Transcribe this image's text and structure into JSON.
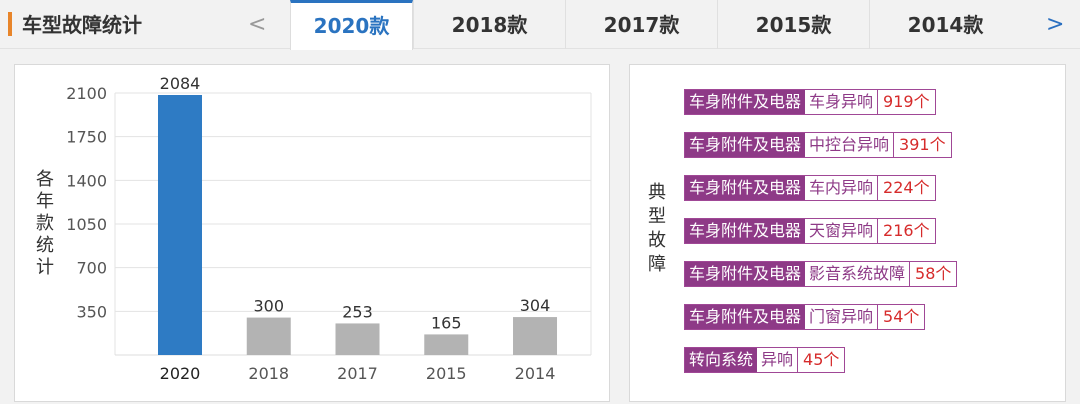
{
  "header": {
    "title": "车型故障统计",
    "prev_arrow": "<",
    "next_arrow": ">",
    "tabs": [
      {
        "label": "2020款",
        "active": true
      },
      {
        "label": "2018款",
        "active": false
      },
      {
        "label": "2017款",
        "active": false
      },
      {
        "label": "2015款",
        "active": false
      },
      {
        "label": "2014款",
        "active": false
      }
    ]
  },
  "chart_panel": {
    "ylabel": "各年款统计"
  },
  "chart_data": {
    "type": "bar",
    "categories": [
      "2020",
      "2018",
      "2017",
      "2015",
      "2014"
    ],
    "values": [
      2084,
      300,
      253,
      165,
      304
    ],
    "yticks": [
      350,
      700,
      1050,
      1400,
      1750,
      2100
    ],
    "ylim": [
      0,
      2100
    ],
    "xlabel": "",
    "ylabel": "各年款统计",
    "grid": true,
    "colors": {
      "highlight": "#2e7bc4",
      "normal": "#b3b3b3"
    }
  },
  "fault_panel": {
    "label": "典型故障",
    "faults": [
      {
        "category": "车身附件及电器",
        "item": "车身异响",
        "count": "919个"
      },
      {
        "category": "车身附件及电器",
        "item": "中控台异响",
        "count": "391个"
      },
      {
        "category": "车身附件及电器",
        "item": "车内异响",
        "count": "224个"
      },
      {
        "category": "车身附件及电器",
        "item": "天窗异响",
        "count": "216个"
      },
      {
        "category": "车身附件及电器",
        "item": "影音系统故障",
        "count": "58个"
      },
      {
        "category": "车身附件及电器",
        "item": "门窗异响",
        "count": "54个"
      },
      {
        "category": "转向系统",
        "item": "异响",
        "count": "45个"
      }
    ]
  }
}
